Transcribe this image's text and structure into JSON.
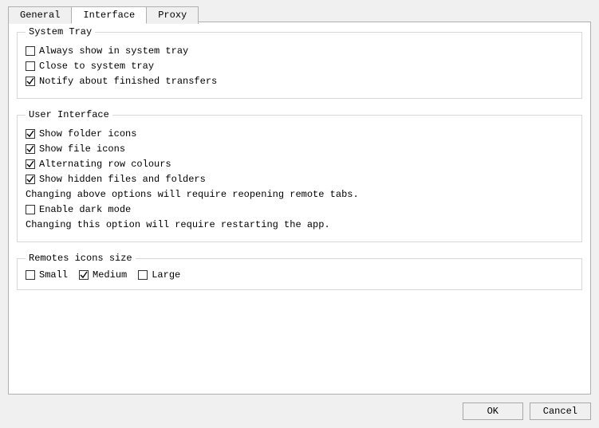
{
  "tabs": {
    "general": "General",
    "interface": "Interface",
    "proxy": "Proxy",
    "active": "interface"
  },
  "groups": {
    "system_tray": {
      "title": "System Tray",
      "always_show": {
        "label": "Always show in system tray",
        "checked": false
      },
      "close_to_tray": {
        "label": "Close to system tray",
        "checked": false
      },
      "notify_finished": {
        "label": "Notify about finished transfers",
        "checked": true
      }
    },
    "user_interface": {
      "title": "User Interface",
      "show_folder_icons": {
        "label": "Show folder icons",
        "checked": true
      },
      "show_file_icons": {
        "label": "Show file icons",
        "checked": true
      },
      "alt_row_colours": {
        "label": "Alternating row colours",
        "checked": true
      },
      "show_hidden": {
        "label": "Show hidden files and folders",
        "checked": true
      },
      "note_reopen": "Changing above options will require reopening remote tabs.",
      "dark_mode": {
        "label": "Enable dark mode",
        "checked": false
      },
      "note_restart": "Changing this option will require restarting the app."
    },
    "remotes_icons": {
      "title": "Remotes icons size",
      "small": {
        "label": "Small",
        "checked": false
      },
      "medium": {
        "label": "Medium",
        "checked": true
      },
      "large": {
        "label": "Large",
        "checked": false
      }
    }
  },
  "buttons": {
    "ok": "OK",
    "cancel": "Cancel"
  }
}
